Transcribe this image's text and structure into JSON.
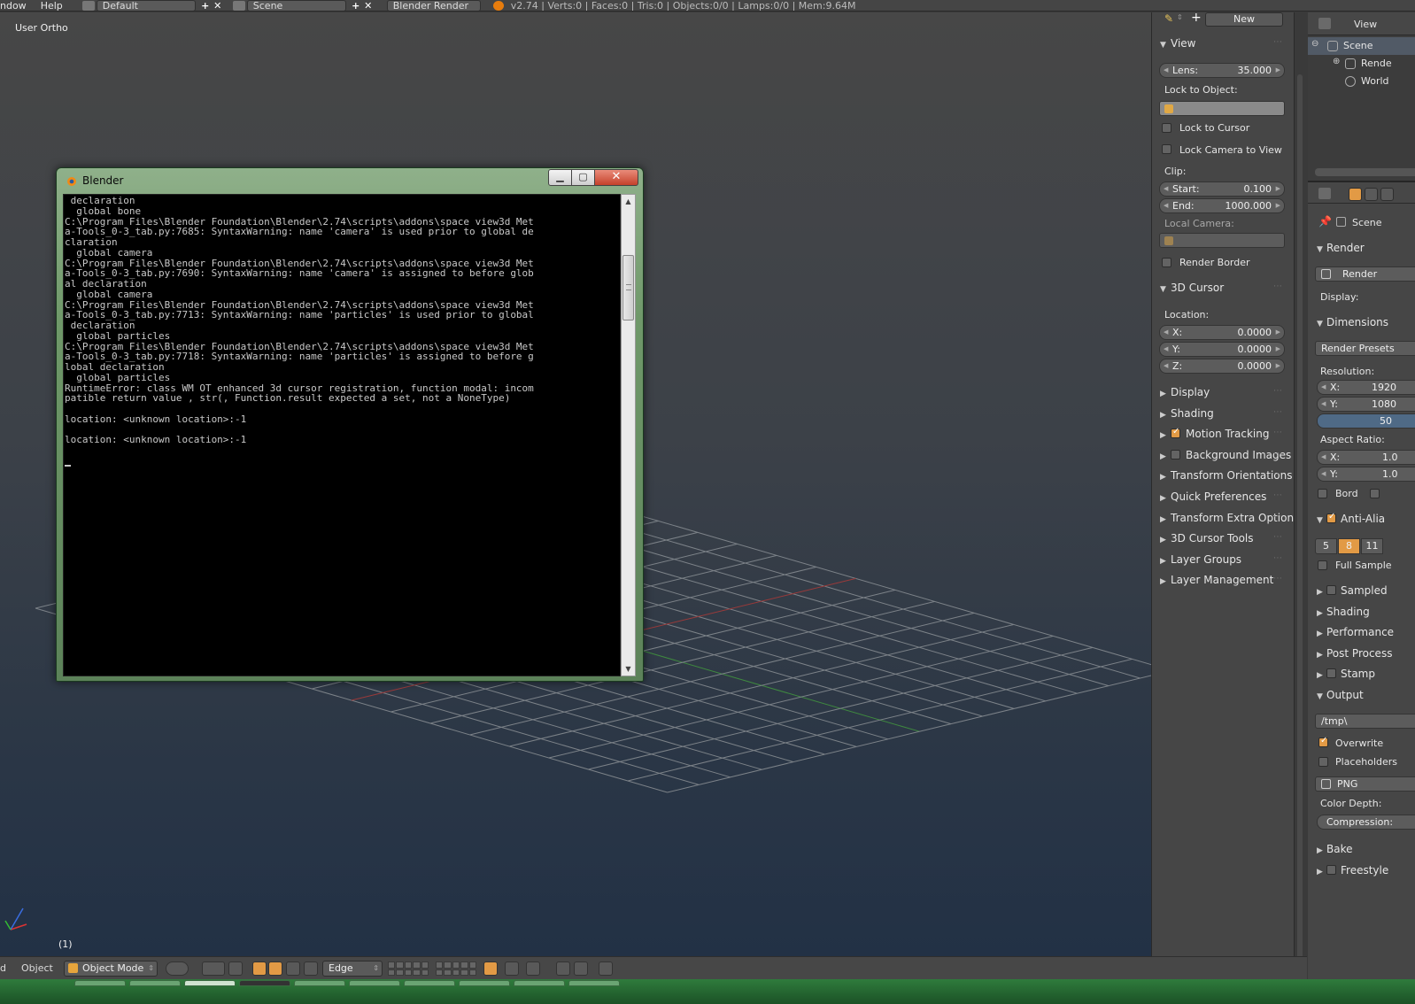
{
  "topbar": {
    "menu_window": "ndow",
    "menu_help": "Help",
    "screen_layout": "Default",
    "scene": "Scene",
    "render_engine": "Blender Render",
    "stats": "v2.74 | Verts:0 | Faces:0 | Tris:0 | Objects:0/0 | Lamps:0/0 | Mem:9.64M"
  },
  "viewport": {
    "view_label": "User Ortho",
    "frame_label": "(1)"
  },
  "console": {
    "title": "Blender",
    "lines": [
      " declaration",
      "  global bone",
      "C:\\Program Files\\Blender Foundation\\Blender\\2.74\\scripts\\addons\\space_view3d_Met",
      "a-Tools_0-3_tab.py:7685: SyntaxWarning: name 'camera' is used prior to global de",
      "claration",
      "  global camera",
      "C:\\Program Files\\Blender Foundation\\Blender\\2.74\\scripts\\addons\\space_view3d_Met",
      "a-Tools_0-3_tab.py:7690: SyntaxWarning: name 'camera' is assigned to before glob",
      "al declaration",
      "  global camera",
      "C:\\Program Files\\Blender Foundation\\Blender\\2.74\\scripts\\addons\\space_view3d_Met",
      "a-Tools_0-3_tab.py:7713: SyntaxWarning: name 'particles' is used prior to global",
      " declaration",
      "  global particles",
      "C:\\Program Files\\Blender Foundation\\Blender\\2.74\\scripts\\addons\\space_view3d_Met",
      "a-Tools_0-3_tab.py:7718: SyntaxWarning: name 'particles' is assigned to before g",
      "lobal declaration",
      "  global particles",
      "RuntimeError: class WM_OT_enhanced_3d_cursor_registration, function modal: incom",
      "patible return value , str(, Function.result expected a set, not a NoneType)",
      "",
      "location: <unknown location>:-1",
      "",
      "location: <unknown location>:-1",
      ""
    ]
  },
  "bottombar": {
    "menu_left": "d",
    "menu_object": "Object",
    "mode": "Object Mode",
    "snap_element": "Edge"
  },
  "npanel": {
    "new_label": "New",
    "view_section": "View",
    "lens_label": "Lens:",
    "lens_value": "35.000",
    "lock_to_object": "Lock to Object:",
    "lock_to_cursor": "Lock to Cursor",
    "lock_camera_to_view": "Lock Camera to View",
    "clip_label": "Clip:",
    "clip_start_label": "Start:",
    "clip_start_value": "0.100",
    "clip_end_label": "End:",
    "clip_end_value": "1000.000",
    "local_camera": "Local Camera:",
    "render_border": "Render Border",
    "cursor_section": "3D Cursor",
    "location_label": "Location:",
    "x_label": "X:",
    "x_value": "0.0000",
    "y_label": "Y:",
    "y_value": "0.0000",
    "z_label": "Z:",
    "z_value": "0.0000",
    "collapsed": [
      {
        "label": "Display",
        "checkbox": false,
        "checked": false
      },
      {
        "label": "Shading",
        "checkbox": false,
        "checked": false
      },
      {
        "label": "Motion Tracking",
        "checkbox": true,
        "checked": true
      },
      {
        "label": "Background Images",
        "checkbox": true,
        "checked": false
      },
      {
        "label": "Transform Orientations",
        "checkbox": false,
        "checked": false
      },
      {
        "label": "Quick Preferences",
        "checkbox": false,
        "checked": false
      },
      {
        "label": "Transform Extra Options",
        "checkbox": false,
        "checked": false
      },
      {
        "label": "3D Cursor Tools",
        "checkbox": false,
        "checked": false
      },
      {
        "label": "Layer Groups",
        "checkbox": false,
        "checked": false
      },
      {
        "label": "Layer Management",
        "checkbox": false,
        "checked": false
      }
    ]
  },
  "outliner": {
    "view_label": "View",
    "items": [
      "Scene",
      "Rende",
      "World"
    ]
  },
  "properties": {
    "context_scene": "Scene",
    "render_section": "Render",
    "render_button": "Render",
    "display_label": "Display:",
    "dimensions_section": "Dimensions",
    "render_presets": "Render Presets",
    "resolution_label": "Resolution:",
    "res_x_label": "X:",
    "res_x_value": "1920",
    "res_y_label": "Y:",
    "res_y_value": "1080",
    "res_pct": "50",
    "aspect_label": "Aspect Ratio:",
    "asp_x_label": "X:",
    "asp_x_value": "1.0",
    "asp_y_label": "Y:",
    "asp_y_value": "1.0",
    "border_label": "Bord",
    "antialias_section": "Anti-Alia",
    "aa_samples": [
      "5",
      "8",
      "11"
    ],
    "full_sample": "Full Sample",
    "sampled_section": "Sampled",
    "shading_section": "Shading",
    "performance_section": "Performance",
    "postprocess_section": "Post Process",
    "stamp_section": "Stamp",
    "output_section": "Output",
    "output_path": "/tmp\\",
    "overwrite": "Overwrite",
    "placeholders": "Placeholders",
    "file_format": "PNG",
    "color_depth": "Color Depth:",
    "compression": "Compression:",
    "bake_section": "Bake",
    "freestyle_section": "Freestyle"
  }
}
